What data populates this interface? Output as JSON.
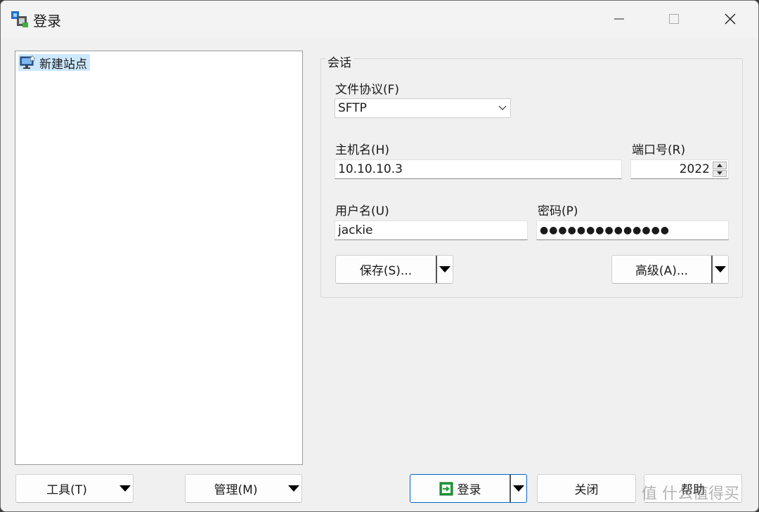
{
  "window": {
    "title": "登录",
    "controls": {
      "minimize": "minimize",
      "maximize": "maximize",
      "close": "close"
    }
  },
  "site_tree": {
    "items": [
      {
        "label": "新建站点",
        "icon": "monitor-star-icon",
        "selected": true
      }
    ]
  },
  "session": {
    "group_label": "会话",
    "protocol": {
      "label": "文件协议(F)",
      "value": "SFTP"
    },
    "host": {
      "label": "主机名(H)",
      "value": "10.10.10.3"
    },
    "port": {
      "label": "端口号(R)",
      "value": "2022"
    },
    "username": {
      "label": "用户名(U)",
      "value": "jackie"
    },
    "password": {
      "label": "密码(P)",
      "value": "●●●●●●●●●●●●●●"
    },
    "save_button": "保存(S)...",
    "advanced_button": "高级(A)..."
  },
  "footer": {
    "tools_button": "工具(T)",
    "manage_button": "管理(M)",
    "login_button": "登录",
    "close_button": "关闭",
    "help_button": "帮助"
  },
  "watermark": "值 什么值得买",
  "colors": {
    "selection": "#cce8ff",
    "accent": "#0067c0",
    "login_icon": "#1e9e3a"
  }
}
